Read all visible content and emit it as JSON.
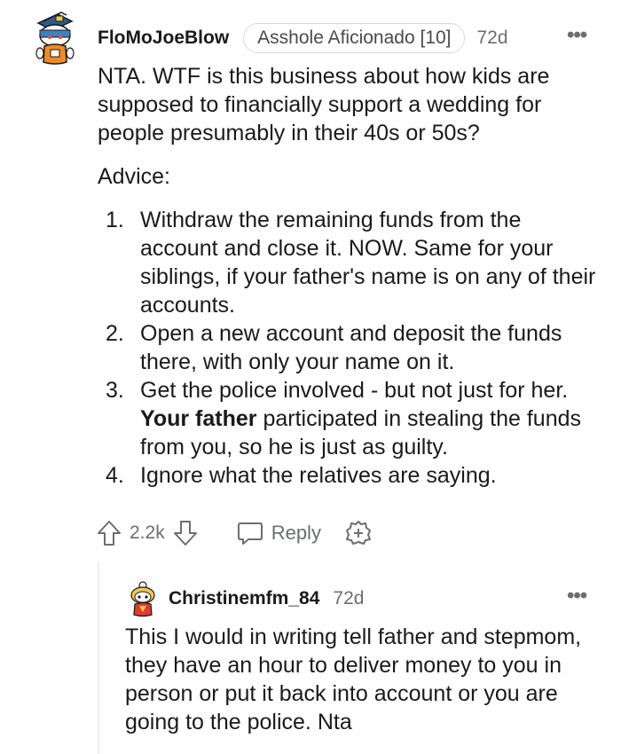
{
  "comment": {
    "username": "FloMoJoeBlow",
    "flair": "Asshole Aficionado [10]",
    "age": "72d",
    "more_icon": "more-horizontal-icon",
    "paragraph1": "NTA. WTF is this business about how kids are supposed to financially support a wedding for people presumably in their 40s or 50s?",
    "paragraph2": "Advice:",
    "advice": [
      {
        "num": "1.",
        "text": "Withdraw the remaining funds from the account and close it. NOW. Same for your siblings, if your father's name is on any of their accounts."
      },
      {
        "num": "2.",
        "text": "Open a new account and deposit the funds there, with only your name on it."
      },
      {
        "num": "3.",
        "pre": "Get the police involved - but not just for her. ",
        "bold": "Your father",
        "post": " participated in stealing the funds from you, so he is just as guilty."
      },
      {
        "num": "4.",
        "text": "Ignore what the relatives are saying."
      }
    ],
    "votes": "2.2k",
    "reply_label": "Reply"
  },
  "reply": {
    "username": "Christinemfm_84",
    "age": "72d",
    "body": "This I would in writing tell father and stepmom, they have an hour to deliver money to you in person or put it back into account or you are going to the police. Nta"
  },
  "colors": {
    "text": "#1a1a1b",
    "muted": "#6b6e70",
    "border": "#d7dadc"
  }
}
